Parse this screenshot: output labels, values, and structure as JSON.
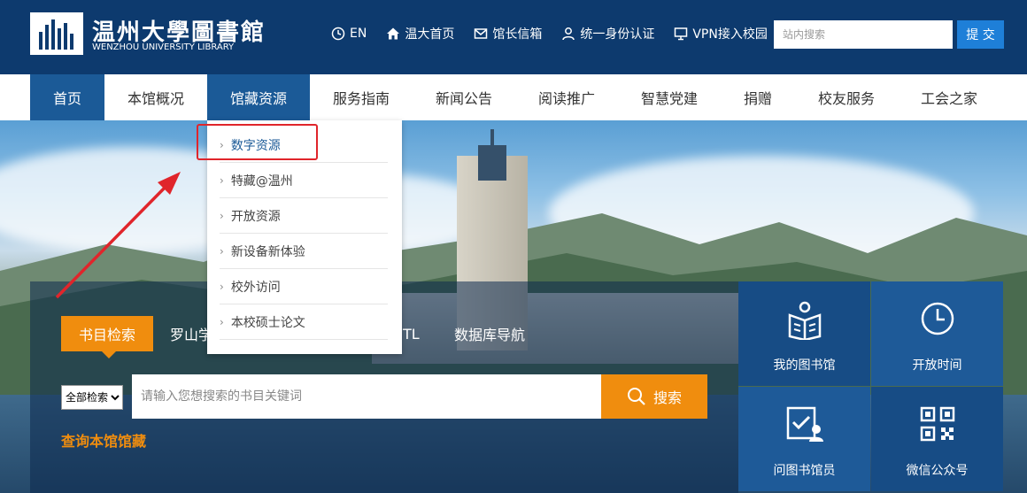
{
  "header": {
    "logo_cn": "温州大學圖書館",
    "logo_en": "WENZHOU UNIVERSITY LIBRARY",
    "links": [
      {
        "label": "EN",
        "icon": "globe-icon"
      },
      {
        "label": "温大首页",
        "icon": "home-icon"
      },
      {
        "label": "馆长信箱",
        "icon": "mail-icon"
      },
      {
        "label": "统一身份认证",
        "icon": "user-icon"
      },
      {
        "label": "VPN接入校园",
        "icon": "monitor-icon"
      }
    ],
    "search_placeholder": "站内搜索",
    "search_button": "提 交"
  },
  "nav": {
    "items": [
      "首页",
      "本馆概况",
      "馆藏资源",
      "服务指南",
      "新闻公告",
      "阅读推广",
      "智慧党建",
      "捐赠",
      "校友服务",
      "工会之家"
    ],
    "active_index": 0,
    "open_index": 2
  },
  "dropdown": {
    "items": [
      "数字资源",
      "特藏@温州",
      "开放资源",
      "新设备新体验",
      "校外访问",
      "本校硕士论文"
    ],
    "highlighted_index": 0
  },
  "search_panel": {
    "tabs": [
      "书目检索",
      "罗山学",
      "TL",
      "数据库导航"
    ],
    "scope_select": "全部检索",
    "keyword_placeholder": "请输入您想搜索的书目关键词",
    "search_button": "搜索",
    "collection_link": "查询本馆馆藏"
  },
  "tiles": [
    {
      "label": "我的图书馆",
      "icon": "book-reader-icon"
    },
    {
      "label": "开放时间",
      "icon": "clock-icon"
    },
    {
      "label": "问图书馆员",
      "icon": "ask-librarian-icon"
    },
    {
      "label": "微信公众号",
      "icon": "qr-code-icon"
    }
  ],
  "colors": {
    "header_bg": "#0d3a6e",
    "nav_active": "#1b5a97",
    "accent_orange": "#f08d0e",
    "submit_blue": "#1e7fd8",
    "annotation_red": "#e0252b"
  }
}
